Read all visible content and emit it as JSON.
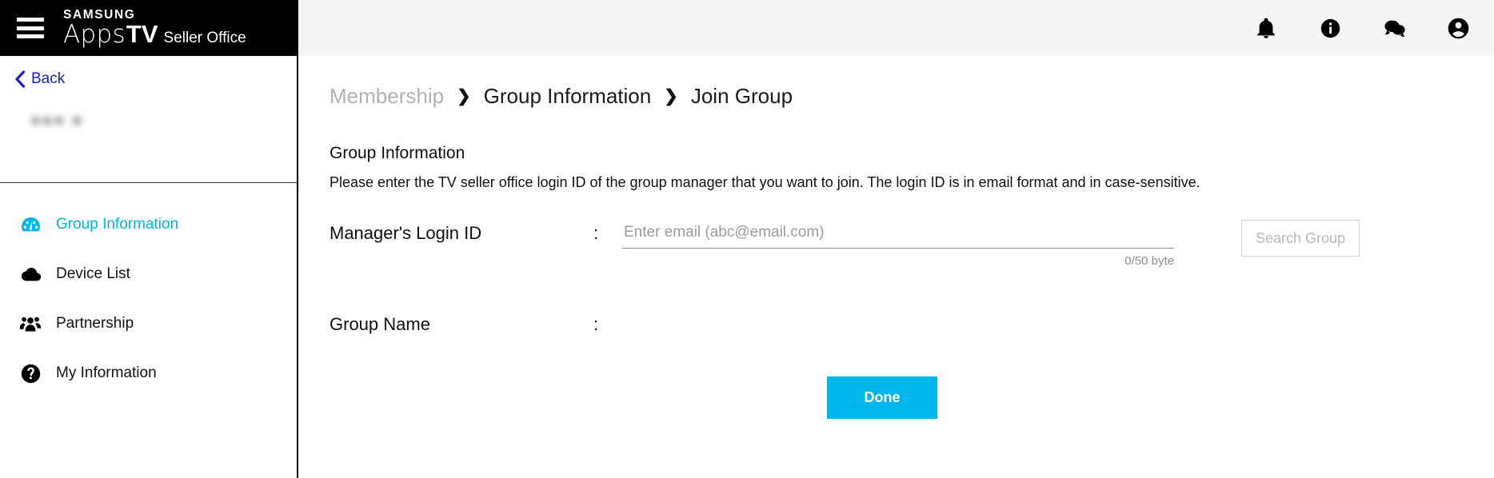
{
  "header": {
    "menu_icon": "hamburger-menu-icon",
    "logo": {
      "samsung": "SAMSUNG",
      "apps": "Apps",
      "tv": "TV",
      "seller_office": "Seller Office"
    },
    "actions": [
      {
        "name": "notifications-icon",
        "icon": "bell-icon"
      },
      {
        "name": "information-icon",
        "icon": "info-circle-icon"
      },
      {
        "name": "messages-icon",
        "icon": "chat-bubbles-icon"
      },
      {
        "name": "account-icon",
        "icon": "account-circle-icon"
      }
    ]
  },
  "sidebar": {
    "back_label": "Back",
    "back_icon": "chevron-left-icon",
    "user_name": "●●● ●",
    "items": [
      {
        "label": "Group Information",
        "icon": "dashboard-gauge-icon",
        "active": true
      },
      {
        "label": "Device List",
        "icon": "cloud-icon",
        "active": false
      },
      {
        "label": "Partnership",
        "icon": "users-group-icon",
        "active": false
      },
      {
        "label": "My Information",
        "icon": "question-circle-icon",
        "active": false
      }
    ]
  },
  "breadcrumb": {
    "separator": "❯",
    "items": [
      {
        "label": "Membership",
        "muted": true
      },
      {
        "label": "Group Information",
        "muted": false
      },
      {
        "label": "Join Group",
        "muted": false
      }
    ]
  },
  "main": {
    "section_title": "Group Information",
    "section_description": "Please enter the TV seller office login ID of the group manager that you want to join. The login ID is in email format and in case-sensitive.",
    "form": {
      "manager_login_id": {
        "label": "Manager's Login ID",
        "colon": ":",
        "value": "",
        "placeholder": "Enter email (abc@email.com)",
        "byte_counter": "0/50 byte"
      },
      "search_group_button": "Search Group",
      "group_name": {
        "label": "Group Name",
        "colon": ":",
        "value": ""
      }
    },
    "done_button": "Done"
  },
  "colors": {
    "accent_cyan": "#00b7eb",
    "link_blue": "#1c1ccc",
    "header_bg": "#f4f4f4",
    "brand_black": "#000000",
    "muted_gray": "#b1b1b1"
  }
}
